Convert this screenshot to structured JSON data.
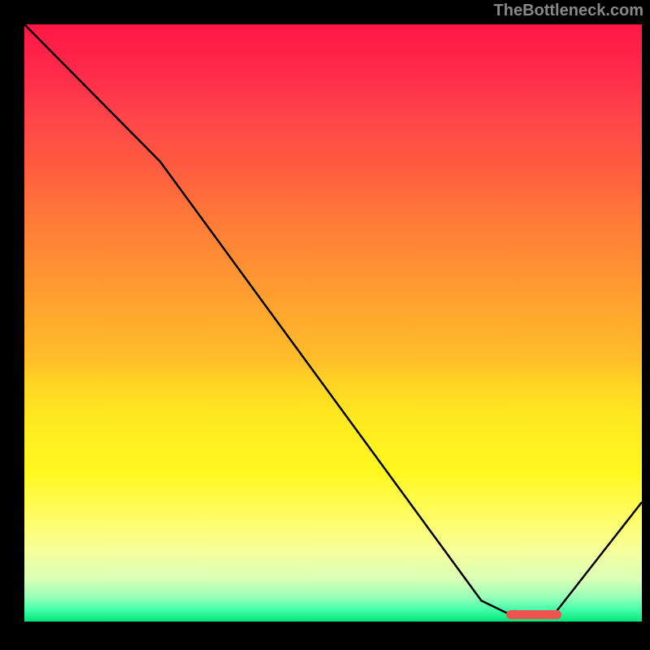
{
  "watermark": "TheBottleneck.com",
  "chart_data": {
    "type": "line",
    "title": "",
    "xlabel": "",
    "ylabel": "",
    "xlim": [
      0,
      100
    ],
    "ylim": [
      0,
      100
    ],
    "x": [
      0,
      22,
      74,
      78,
      86,
      100
    ],
    "values": [
      100,
      77,
      3.5,
      1.5,
      1.5,
      20
    ],
    "marker": {
      "x_start": 78,
      "x_end": 87,
      "y": 1.2
    },
    "gradient_stops": [
      {
        "pos": 0,
        "color": "#ff1744"
      },
      {
        "pos": 50,
        "color": "#ffb300"
      },
      {
        "pos": 80,
        "color": "#ffee58"
      },
      {
        "pos": 100,
        "color": "#00e676"
      }
    ]
  }
}
